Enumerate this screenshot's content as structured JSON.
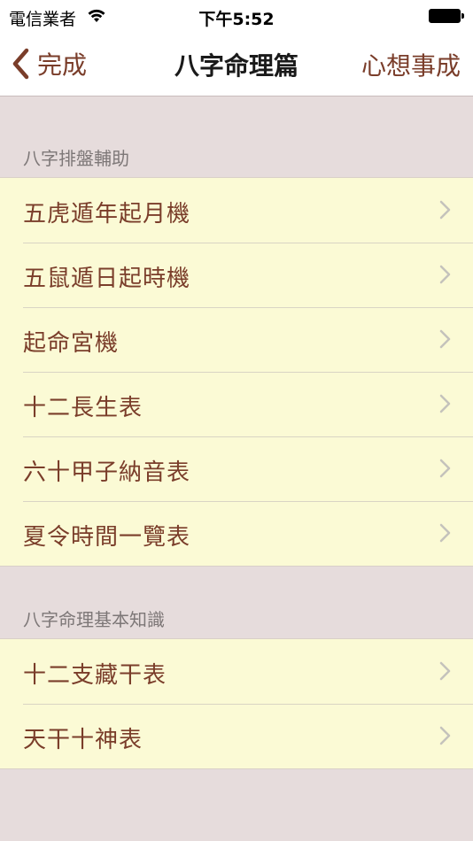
{
  "status": {
    "carrier": "電信業者",
    "time": "下午5:52"
  },
  "nav": {
    "back_label": "完成",
    "title": "八字命理篇",
    "right_label": "心想事成"
  },
  "sections": [
    {
      "header": "八字排盤輔助",
      "items": [
        "五虎遁年起月機",
        "五鼠遁日起時機",
        "起命宮機",
        "十二長生表",
        "六十甲子納音表",
        "夏令時間一覽表"
      ]
    },
    {
      "header": "八字命理基本知識",
      "items": [
        "十二支藏干表",
        "天干十神表"
      ]
    }
  ],
  "colors": {
    "accent": "#7a3d2a",
    "cell_background": "#fbfad5",
    "page_background": "#e6dcdc"
  }
}
